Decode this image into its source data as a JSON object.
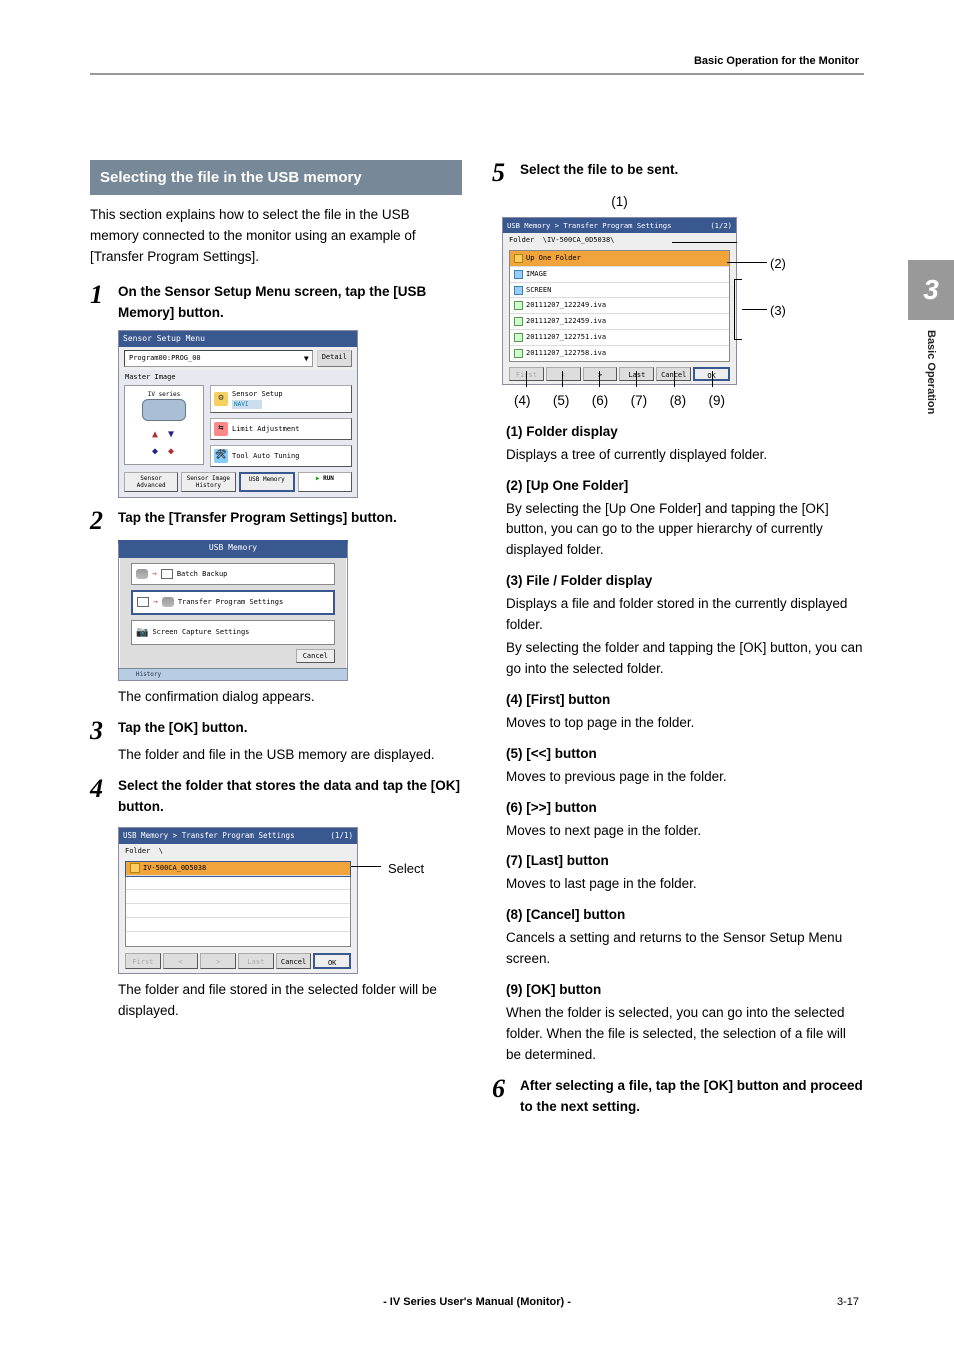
{
  "header": {
    "right": "Basic Operation for the Monitor"
  },
  "sideTab": {
    "num": "3",
    "label": "Basic Operation"
  },
  "left": {
    "sectionTitle": "Selecting the file in the USB memory",
    "intro": "This section explains how to select the file in the USB memory connected to the monitor using an example of [Transfer Program Settings].",
    "steps": {
      "s1": {
        "num": "1",
        "text": "On the Sensor Setup Menu screen, tap the [USB Memory] button."
      },
      "s2": {
        "num": "2",
        "text": "Tap the [Transfer Program Settings] button.",
        "sub": "The confirmation dialog appears."
      },
      "s3": {
        "num": "3",
        "text": "Tap the [OK] button.",
        "sub": "The folder and file in the USB memory are displayed."
      },
      "s4": {
        "num": "4",
        "text": "Select the folder that stores the data and tap the [OK] button.",
        "sub": "The folder and file stored in the selected folder will be displayed."
      }
    },
    "ssA": {
      "title": "Sensor Setup Menu",
      "prog": "Program00:PROG_00",
      "detail": "Detail",
      "masterLabel": "Master Image",
      "ivSeries": "IV series",
      "navi": "NAVI",
      "btnSetup": "Sensor Setup",
      "btnLimit": "Limit Adjustment",
      "btnTool": "Tool Auto Tuning",
      "botSensor": "Sensor Advanced",
      "botHist": "Sensor Image History",
      "botUsb": "USB Memory",
      "botRun": "RUN"
    },
    "ssB": {
      "title": "USB Memory",
      "batch": "Batch Backup",
      "transfer": "Transfer Program Settings",
      "capture": "Screen Capture Settings",
      "cancel": "Cancel",
      "history": "History"
    },
    "ssC": {
      "title": "USB Memory > Transfer Program Settings",
      "page": "(1/1)",
      "folderLabel": "Folder",
      "folderPath": "\\",
      "row1": "IV-500CA_0D5038",
      "first": "First",
      "lt": "<",
      "gt": ">",
      "last": "Last",
      "cancel": "Cancel",
      "ok": "OK",
      "selectLabel": "Select"
    }
  },
  "right": {
    "steps": {
      "s5": {
        "num": "5",
        "text": "Select the file to be sent."
      },
      "s6": {
        "num": "6",
        "text": "After selecting a file, tap the [OK] button and proceed to the next setting."
      }
    },
    "ssD": {
      "title": "USB Memory > Transfer Program Settings",
      "page": "(1/2)",
      "folderLabel": "Folder",
      "folderPath": "\\IV-500CA_0D5038\\",
      "rowUp": "Up One Folder",
      "rowImage": "IMAGE",
      "rowScreen": "SCREEN",
      "file1": "20111207_122249.iva",
      "file2": "20111207_122459.iva",
      "file3": "20111207_122751.iva",
      "file4": "20111207_122758.iva",
      "first": "First",
      "lt": "<",
      "gt": ">",
      "last": "Last",
      "cancel": "Cancel",
      "ok": "OK"
    },
    "callouts": {
      "c1": "(1)",
      "c2": "(2)",
      "c3": "(3)",
      "c4": "(4)",
      "c5": "(5)",
      "c6": "(6)",
      "c7": "(7)",
      "c8": "(8)",
      "c9": "(9)"
    },
    "annos": {
      "a1h": "(1)  Folder display",
      "a1b": "Displays a tree of currently displayed folder.",
      "a2h": "(2)  [Up One Folder]",
      "a2b": "By selecting the [Up One Folder] and tapping the [OK] button, you can go to the upper hierarchy of currently displayed folder.",
      "a3h": "(3)  File / Folder display",
      "a3b": "Displays a file and folder stored in the currently displayed folder.",
      "a3b2": "By selecting the folder and tapping the [OK] button, you can go into the selected folder.",
      "a4h": "(4)  [First] button",
      "a4b": "Moves to top page in the folder.",
      "a5h": "(5)  [<<] button",
      "a5b": "Moves to previous page in the folder.",
      "a6h": "(6)  [>>] button",
      "a6b": "Moves to next page in the folder.",
      "a7h": "(7)  [Last] button",
      "a7b": "Moves to last page in the folder.",
      "a8h": "(8)  [Cancel] button",
      "a8b": "Cancels a setting and returns to the Sensor Setup Menu screen.",
      "a9h": "(9)  [OK] button",
      "a9b": "When the folder is selected, you can go into the selected folder. When the file is selected, the selection of a file will be determined."
    }
  },
  "footer": {
    "center": "- IV Series User's Manual (Monitor) -",
    "num": "3-17"
  }
}
